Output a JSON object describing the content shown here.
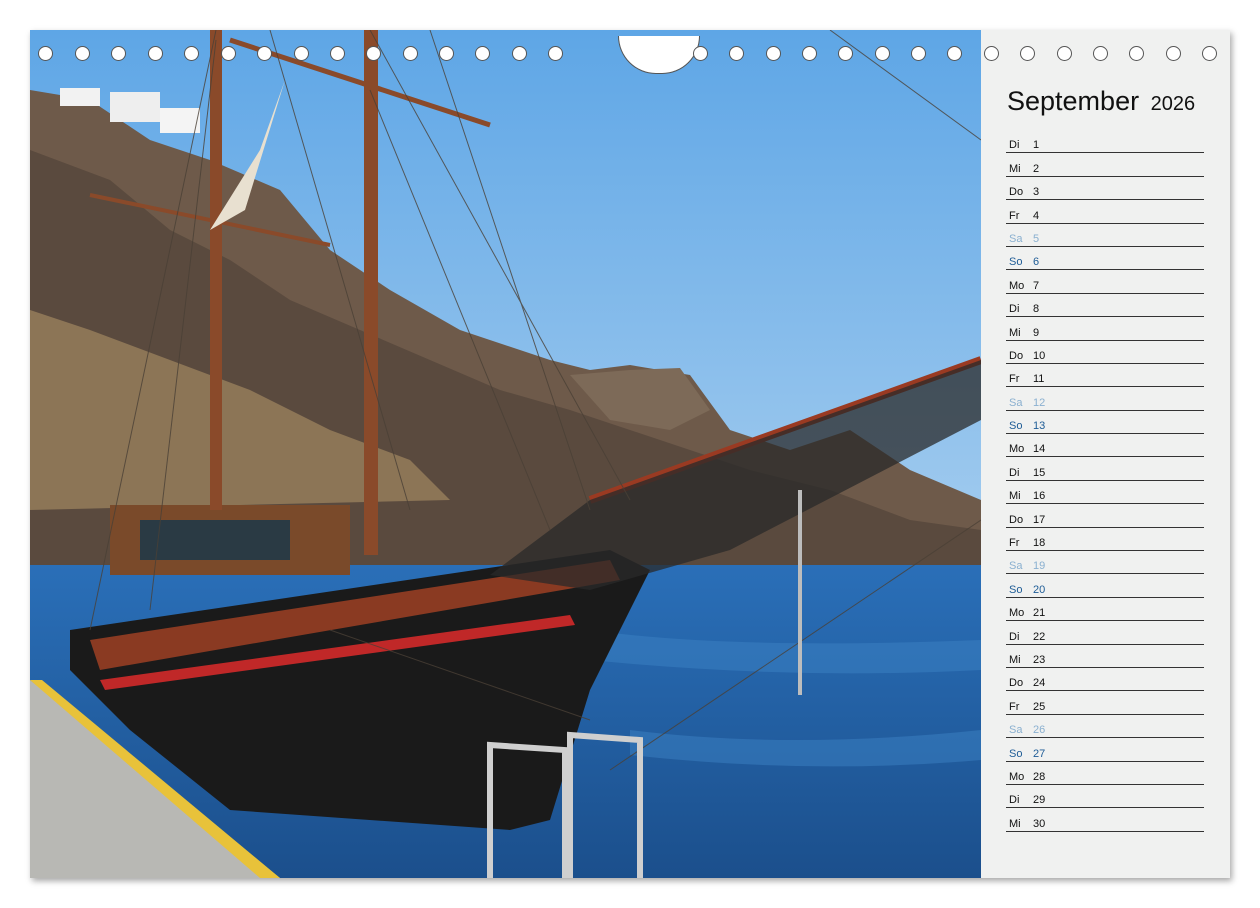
{
  "calendar": {
    "month": "September",
    "year": "2026",
    "days": [
      {
        "name": "Di",
        "num": "1",
        "type": "weekday"
      },
      {
        "name": "Mi",
        "num": "2",
        "type": "weekday"
      },
      {
        "name": "Do",
        "num": "3",
        "type": "weekday"
      },
      {
        "name": "Fr",
        "num": "4",
        "type": "weekday"
      },
      {
        "name": "Sa",
        "num": "5",
        "type": "saturday"
      },
      {
        "name": "So",
        "num": "6",
        "type": "sunday"
      },
      {
        "name": "Mo",
        "num": "7",
        "type": "weekday"
      },
      {
        "name": "Di",
        "num": "8",
        "type": "weekday"
      },
      {
        "name": "Mi",
        "num": "9",
        "type": "weekday"
      },
      {
        "name": "Do",
        "num": "10",
        "type": "weekday"
      },
      {
        "name": "Fr",
        "num": "11",
        "type": "weekday"
      },
      {
        "name": "Sa",
        "num": "12",
        "type": "saturday"
      },
      {
        "name": "So",
        "num": "13",
        "type": "sunday"
      },
      {
        "name": "Mo",
        "num": "14",
        "type": "weekday"
      },
      {
        "name": "Di",
        "num": "15",
        "type": "weekday"
      },
      {
        "name": "Mi",
        "num": "16",
        "type": "weekday"
      },
      {
        "name": "Do",
        "num": "17",
        "type": "weekday"
      },
      {
        "name": "Fr",
        "num": "18",
        "type": "weekday"
      },
      {
        "name": "Sa",
        "num": "19",
        "type": "saturday"
      },
      {
        "name": "So",
        "num": "20",
        "type": "sunday"
      },
      {
        "name": "Mo",
        "num": "21",
        "type": "weekday"
      },
      {
        "name": "Di",
        "num": "22",
        "type": "weekday"
      },
      {
        "name": "Mi",
        "num": "23",
        "type": "weekday"
      },
      {
        "name": "Do",
        "num": "24",
        "type": "weekday"
      },
      {
        "name": "Fr",
        "num": "25",
        "type": "weekday"
      },
      {
        "name": "Sa",
        "num": "26",
        "type": "saturday"
      },
      {
        "name": "So",
        "num": "27",
        "type": "sunday"
      },
      {
        "name": "Mo",
        "num": "28",
        "type": "weekday"
      },
      {
        "name": "Di",
        "num": "29",
        "type": "weekday"
      },
      {
        "name": "Mi",
        "num": "30",
        "type": "weekday"
      }
    ]
  },
  "colors": {
    "saturday": "#8ab0d0",
    "sunday": "#1e5c96",
    "panel": "#f0f1f0"
  }
}
